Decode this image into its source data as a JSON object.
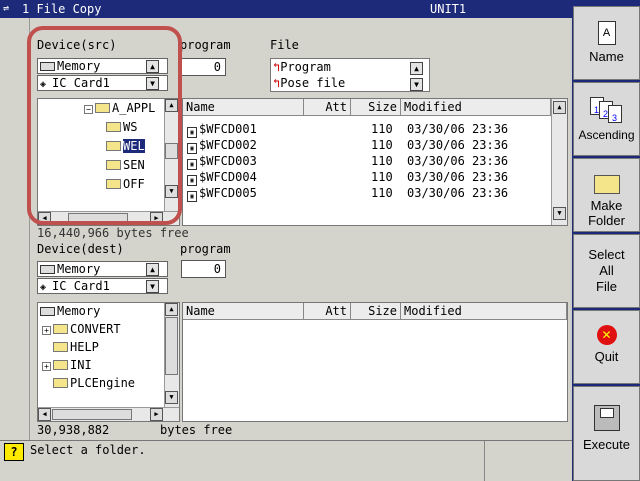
{
  "title_bar": {
    "title": "1 File Copy",
    "unit": "UNIT1"
  },
  "src": {
    "device_label": "Device(src)",
    "device_options": [
      "Memory",
      "IC Card1"
    ],
    "program_label": "program",
    "program_value": "0",
    "file_label": "File",
    "file_options": [
      "Program",
      "Pose file"
    ],
    "tree": [
      "A_APPL",
      "WS",
      "WEL",
      "SEN",
      "OFF"
    ],
    "free": "16,440,966 bytes free",
    "columns": [
      "Name",
      "Att",
      "Size",
      "Modified"
    ],
    "files": [
      {
        "name": "$WFCD001",
        "size": "110",
        "modified": "03/30/06 23:36"
      },
      {
        "name": "$WFCD002",
        "size": "110",
        "modified": "03/30/06 23:36"
      },
      {
        "name": "$WFCD003",
        "size": "110",
        "modified": "03/30/06 23:36"
      },
      {
        "name": "$WFCD004",
        "size": "110",
        "modified": "03/30/06 23:36"
      },
      {
        "name": "$WFCD005",
        "size": "110",
        "modified": "03/30/06 23:36"
      }
    ]
  },
  "dest": {
    "device_label": "Device(dest)",
    "device_options": [
      "Memory",
      "IC Card1"
    ],
    "program_label": "program",
    "program_value": "0",
    "tree": [
      "Memory",
      "CONVERT",
      "HELP",
      "INI",
      "PLCEngine"
    ],
    "free_value": "30,938,882",
    "free_suffix": "bytes free",
    "columns": [
      "Name",
      "Att",
      "Size",
      "Modified"
    ]
  },
  "status": {
    "message": "Select a folder."
  },
  "side_buttons": [
    {
      "label": "Name",
      "icon": "name-sort-icon"
    },
    {
      "label": "Ascending",
      "icon": "ascending-icon"
    },
    {
      "label": "Make Folder",
      "label1": "Make",
      "label2": "Folder",
      "icon": "folder-icon"
    },
    {
      "label": "Select All File",
      "label1": "Select",
      "label2": "All",
      "label3": "File"
    },
    {
      "label": "Quit",
      "icon": "quit-icon"
    },
    {
      "label": "Execute",
      "icon": "execute-icon"
    }
  ],
  "colors": {
    "titlebar": "#1d2a7a",
    "highlight": "#c0504d",
    "quit": "#e01010",
    "folder": "#f4e58a"
  }
}
